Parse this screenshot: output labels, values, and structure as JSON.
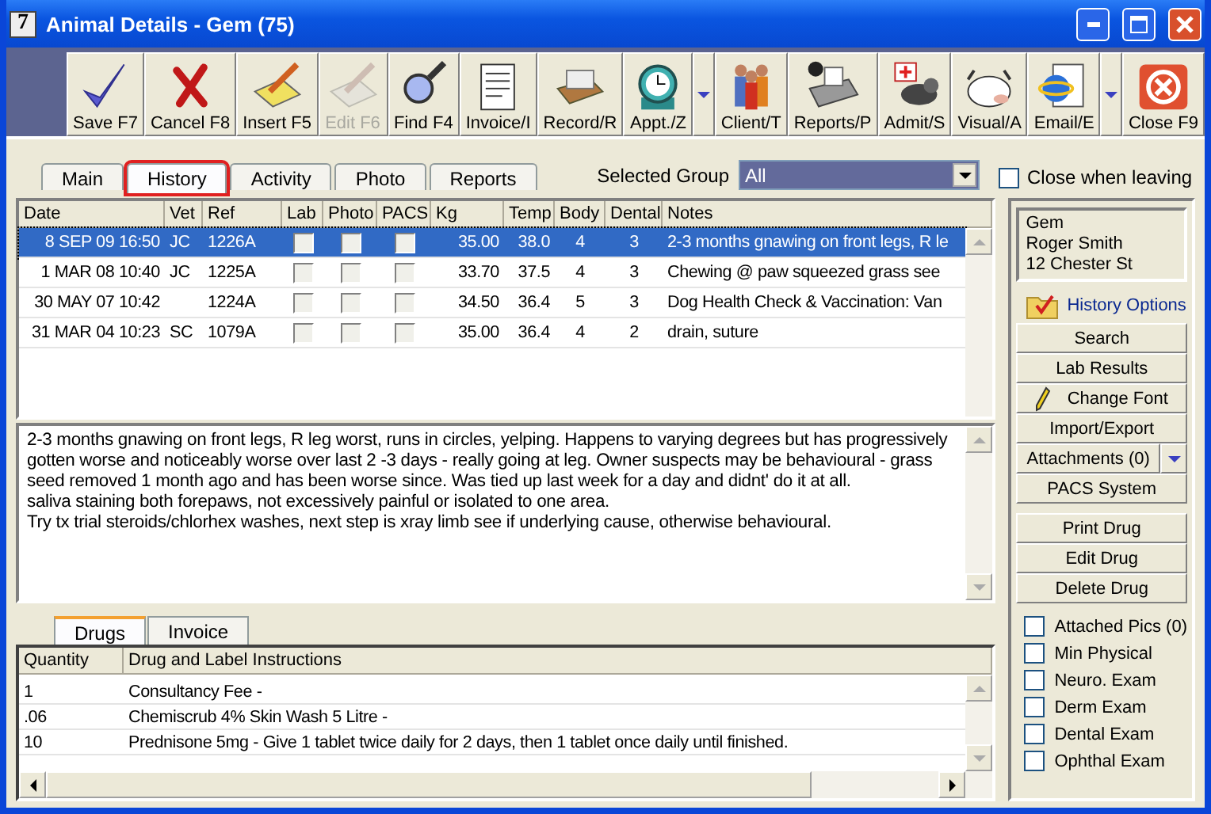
{
  "window": {
    "title": "Animal Details - Gem (75)",
    "app_badge": "7"
  },
  "toolbar": [
    {
      "label": "Save F7",
      "disabled": false,
      "dropdown": false
    },
    {
      "label": "Cancel F8",
      "disabled": false,
      "dropdown": false
    },
    {
      "label": "Insert F5",
      "disabled": false,
      "dropdown": false
    },
    {
      "label": "Edit F6",
      "disabled": true,
      "dropdown": false
    },
    {
      "label": "Find F4",
      "disabled": false,
      "dropdown": false
    },
    {
      "label": "Invoice/I",
      "disabled": false,
      "dropdown": false
    },
    {
      "label": "Record/R",
      "disabled": false,
      "dropdown": false
    },
    {
      "label": "Appt./Z",
      "disabled": false,
      "dropdown": true
    },
    {
      "label": "Client/T",
      "disabled": false,
      "dropdown": false
    },
    {
      "label": "Reports/P",
      "disabled": false,
      "dropdown": false
    },
    {
      "label": "Admit/S",
      "disabled": false,
      "dropdown": false
    },
    {
      "label": "Visual/A",
      "disabled": false,
      "dropdown": false
    },
    {
      "label": "Email/E",
      "disabled": false,
      "dropdown": true
    },
    {
      "label": "Close F9",
      "disabled": false,
      "dropdown": false
    }
  ],
  "tabs": [
    {
      "label": "Main",
      "selected": false
    },
    {
      "label": "History",
      "selected": true
    },
    {
      "label": "Activity",
      "selected": false
    },
    {
      "label": "Photo",
      "selected": false
    },
    {
      "label": "Reports",
      "selected": false
    }
  ],
  "selected_group": {
    "label": "Selected Group",
    "value": "All"
  },
  "close_when_leaving": {
    "label": "Close when leaving",
    "checked": false
  },
  "history_table": {
    "columns": [
      "Date",
      "Vet",
      "Ref",
      "Lab",
      "Photo",
      "PACS",
      "Kg",
      "Temp",
      "Body",
      "Dental",
      "Notes"
    ],
    "rows": [
      {
        "date": "8 SEP 09  16:50",
        "vet": "JC",
        "ref": "1226A",
        "lab": false,
        "photo": false,
        "pacs": false,
        "kg": "35.00",
        "temp": "38.0",
        "body": "4",
        "dental": "3",
        "notes": "2-3 months gnawing on front legs, R le",
        "selected": true
      },
      {
        "date": "1 MAR 08  10:40",
        "vet": "JC",
        "ref": "1225A",
        "lab": false,
        "photo": false,
        "pacs": false,
        "kg": "33.70",
        "temp": "37.5",
        "body": "4",
        "dental": "3",
        "notes": "Chewing @ paw   squeezed grass see",
        "selected": false
      },
      {
        "date": "30 MAY 07  10:42",
        "ref": "1224A",
        "lab": false,
        "photo": false,
        "pacs": false,
        "kg": "34.50",
        "temp": "36.4",
        "body": "5",
        "dental": "3",
        "notes": "Dog Health Check & Vaccination: Van",
        "selected": false
      },
      {
        "date": "31 MAR 04  10:23",
        "vet": "SC",
        "ref": "1079A",
        "lab": false,
        "photo": false,
        "pacs": false,
        "kg": "35.00",
        "temp": "36.4",
        "body": "4",
        "dental": "2",
        "notes": "drain, suture",
        "selected": false
      }
    ]
  },
  "notes": [
    "2-3 months gnawing on front legs, R leg worst, runs in circles, yelping. Happens to varying degrees but has progressively gotten worse and noticeably worse over last 2 -3 days - really going at leg. Owner suspects may be behavioural - grass seed removed 1 month ago and has been worse since. Was tied up last week for a day and didnt' do it at all.",
    "saliva staining both forepaws, not excessively painful or isolated to one area.",
    "Try tx trial steroids/chlorhex washes, next step is xray limb see if underlying cause, otherwise behavioural."
  ],
  "lower_tabs": [
    {
      "label": "Drugs",
      "selected": true
    },
    {
      "label": "Invoice",
      "selected": false
    }
  ],
  "drug_table": {
    "columns": [
      "Quantity",
      "Drug and Label Instructions"
    ],
    "rows": [
      {
        "quantity": "1",
        "instructions": "Consultancy Fee -"
      },
      {
        "quantity": ".06",
        "instructions": "Chemiscrub 4% Skin Wash 5 Litre -"
      },
      {
        "quantity": "10",
        "instructions": "Prednisone 5mg - Give 1 tablet twice daily for 2 days, then 1 tablet once daily until finished."
      }
    ]
  },
  "client_info": [
    "Gem",
    "Roger Smith",
    "12 Chester St"
  ],
  "history_options": {
    "title": "History Options",
    "buttons": [
      {
        "label": "Search",
        "kind": "plain"
      },
      {
        "label": "Lab Results",
        "kind": "plain"
      },
      {
        "label": "Change Font",
        "kind": "pencil"
      },
      {
        "label": "Import/Export",
        "kind": "plain"
      },
      {
        "label": "Attachments (0)",
        "kind": "dropdown"
      },
      {
        "label": "PACS System",
        "kind": "plain"
      }
    ]
  },
  "drug_buttons": [
    "Print Drug",
    "Edit Drug",
    "Delete Drug"
  ],
  "exam_checks": [
    {
      "label": "Attached Pics (0)",
      "checked": false
    },
    {
      "label": "Min Physical",
      "checked": false
    },
    {
      "label": "Neuro. Exam",
      "checked": false
    },
    {
      "label": "Derm Exam",
      "checked": false
    },
    {
      "label": "Dental Exam",
      "checked": false
    },
    {
      "label": "Ophthal Exam",
      "checked": false
    }
  ]
}
